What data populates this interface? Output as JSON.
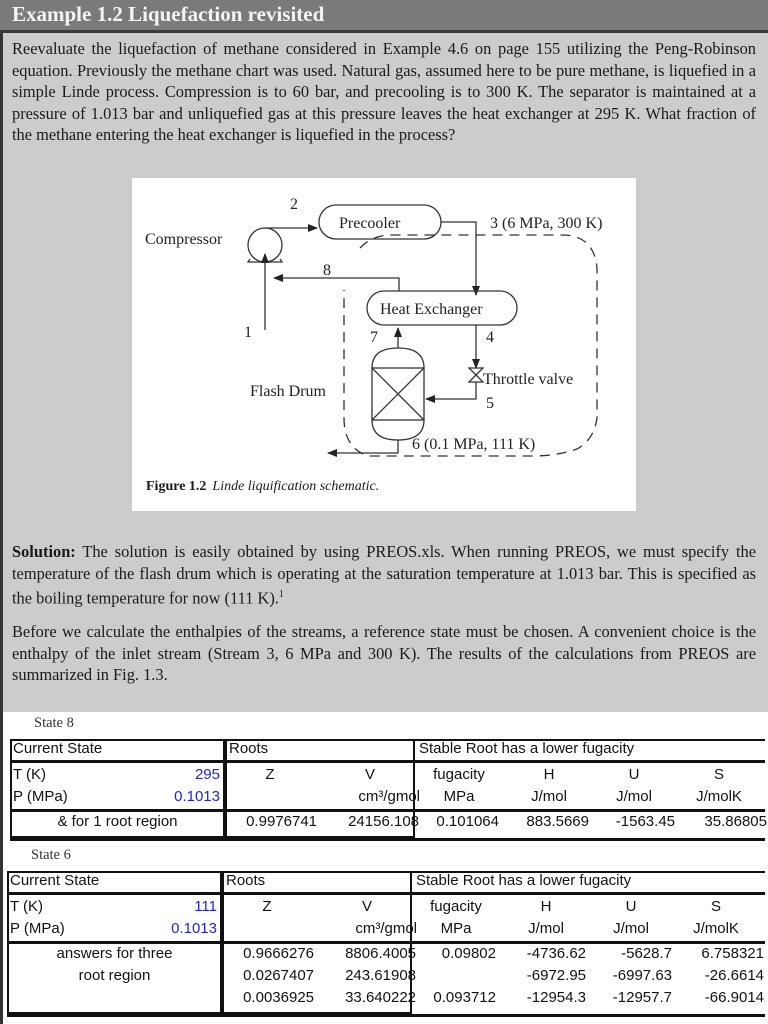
{
  "example": {
    "title": "Example 1.2  Liquefaction revisited",
    "problem_text": "Reevaluate the liquefaction of methane considered in Example 4.6 on page 155 utilizing the Peng-Robinson equation. Previously the methane chart was used. Natural gas, assumed here to be pure methane, is liquefied in a simple Linde process. Compression is to 60 bar, and precooling is to 300 K. The separator is maintained at a pressure of 1.013 bar and unliquefied gas at this pressure leaves the heat exchanger at 295 K. What fraction of the methane entering the heat exchanger is liquefied in the process?"
  },
  "figure": {
    "caption_label": "Figure 1.2",
    "caption_text": "Linde liquification schematic.",
    "labels": {
      "compressor": "Compressor",
      "precooler": "Precooler",
      "heat_exchanger": "Heat Exchanger",
      "flash_drum": "Flash Drum",
      "throttle_valve": "Throttle valve",
      "stream_1": "1",
      "stream_2": "2",
      "stream_3": "3 (6 MPa, 300 K)",
      "stream_4": "4",
      "stream_5": "5",
      "stream_6": "6 (0.1 MPa, 111 K)",
      "stream_7": "7",
      "stream_8": "8"
    }
  },
  "solution": {
    "label": "Solution:",
    "para1": " The solution is easily obtained by using PREOS.xls. When running PREOS, we must specify the temperature of the flash drum which is operating at the saturation temperature at 1.013 bar. This is specified as the boiling temperature for now (111 K).",
    "footnote_mark": "1",
    "para2": "Before we calculate the enthalpies of the streams, a reference state must be chosen. A convenient choice is the enthalpy of the inlet stream (Stream 3, 6 MPa and 300 K). The results of the calculations from PREOS are summarized in Fig. 1.3."
  },
  "tables": [
    {
      "state_label": "State 8",
      "current_state_header": "Current State",
      "roots_header": "Roots",
      "stable_header": "Stable Root has a lower fugacity",
      "T_label": "T (K)",
      "T_value": "295",
      "P_label": "P (MPa)",
      "P_value": "0.1013",
      "region_label": [
        "& for 1 root region"
      ],
      "col_Z": "Z",
      "col_V": "V",
      "col_V_unit": "cm³/gmol",
      "col_f": "fugacity",
      "col_f_unit": "MPa",
      "col_H": "H",
      "col_H_unit": "J/mol",
      "col_U": "U",
      "col_U_unit": "J/mol",
      "col_S": "S",
      "col_S_unit": "J/molK",
      "rows": [
        {
          "Z": "0.9976741",
          "V": "24156.108",
          "f": "0.101064",
          "H": "883.5669",
          "U": "-1563.45",
          "S": "35.86805"
        }
      ]
    },
    {
      "state_label": "State 6",
      "current_state_header": "Current State",
      "roots_header": "Roots",
      "stable_header": "Stable Root has a lower fugacity",
      "T_label": "T (K)",
      "T_value": "111",
      "P_label": "P (MPa)",
      "P_value": "0.1013",
      "region_label": [
        "answers for three",
        "root region"
      ],
      "col_Z": "Z",
      "col_V": "V",
      "col_V_unit": "cm³/gmol",
      "col_f": "fugacity",
      "col_f_unit": "MPa",
      "col_H": "H",
      "col_H_unit": "J/mol",
      "col_U": "U",
      "col_U_unit": "J/mol",
      "col_S": "S",
      "col_S_unit": "J/molK",
      "rows": [
        {
          "Z": "0.9666276",
          "V": "8806.4005",
          "f": "0.09802",
          "H": "-4736.62",
          "U": "-5628.7",
          "S": "6.758321"
        },
        {
          "Z": "0.0267407",
          "V": "243.61908",
          "f": "",
          "H": "-6972.95",
          "U": "-6997.63",
          "S": "-26.6614"
        },
        {
          "Z": "0.0036925",
          "V": "33.640222",
          "f": "0.093712",
          "H": "-12954.3",
          "U": "-12957.7",
          "S": "-66.9014"
        }
      ]
    }
  ]
}
